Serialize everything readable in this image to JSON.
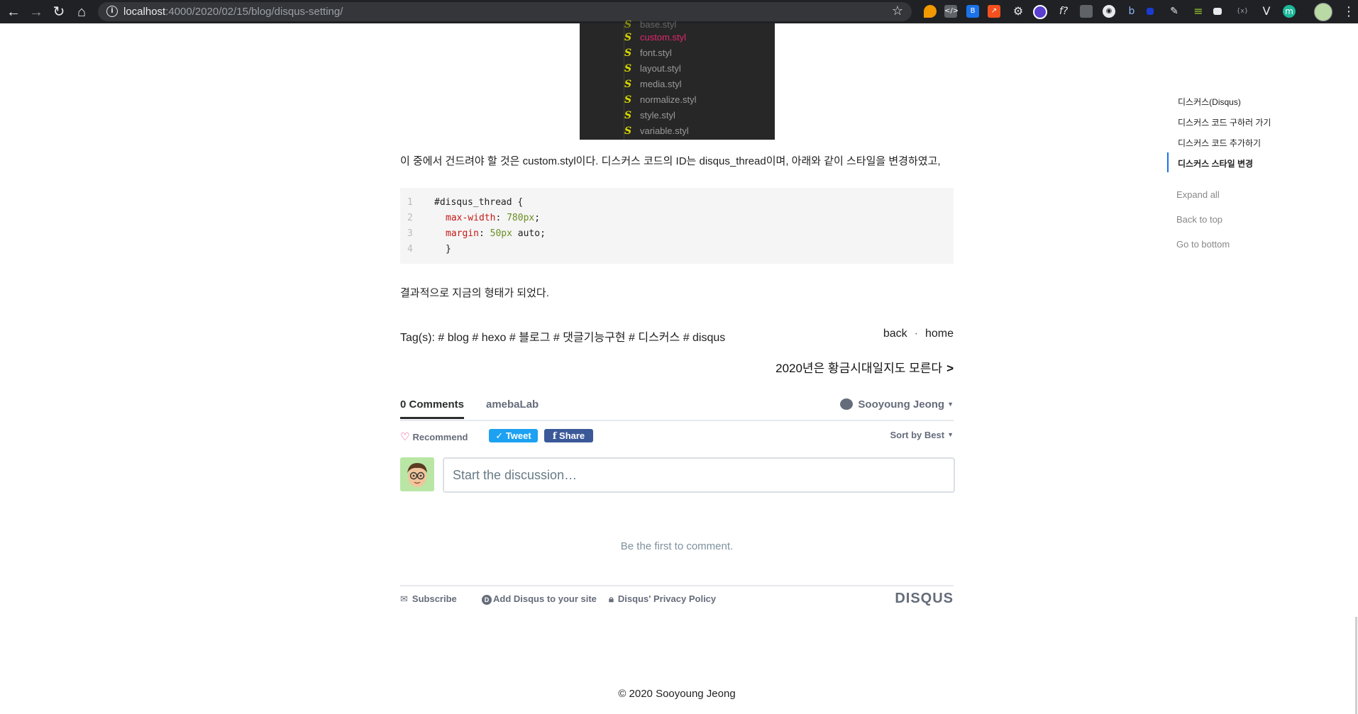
{
  "browser": {
    "url_host": "localhost",
    "url_path": ":4000/2020/02/15/blog/disqus-setting/"
  },
  "filetree": {
    "items": [
      {
        "label": "custom.styl",
        "active": true
      },
      {
        "label": "font.styl",
        "active": false
      },
      {
        "label": "layout.styl",
        "active": false
      },
      {
        "label": "media.styl",
        "active": false
      },
      {
        "label": "normalize.styl",
        "active": false
      },
      {
        "label": "style.styl",
        "active": false
      },
      {
        "label": "variable.styl",
        "active": false
      }
    ]
  },
  "article": {
    "paragraph1": "이 중에서 건드려야 할 것은 custom.styl이다. 디스커스 코드의 ID는 disqus_thread이며, 아래와 같이 스타일을 변경하였고,",
    "code": {
      "line_numbers": [
        "1",
        "2",
        "3",
        "4"
      ],
      "line1": "#disqus_thread {",
      "line2_key": "max-width",
      "line2_val": "780px",
      "line3_key": "margin",
      "line3_val": "50px",
      "line3_rest": " auto;",
      "line4": "}"
    },
    "paragraph2": "결과적으로 지금의 형태가 되었다.",
    "tags_label": "Tag(s):",
    "tags": [
      "# blog",
      "# hexo",
      "# 블로그",
      "# 댓글기능구현",
      "# 디스커스",
      "# disqus"
    ],
    "back": "back",
    "dot": "·",
    "home": "home",
    "next_post": "2020년은 황금시대일지도 모른다",
    "next_arrow": ">"
  },
  "disqus": {
    "comments_tab": "0 Comments",
    "forum_tab": "amebaLab",
    "user": "Sooyoung Jeong",
    "recommend": "Recommend",
    "tweet": "Tweet",
    "share": "Share",
    "sort": "Sort by Best",
    "placeholder": "Start the discussion…",
    "first": "Be the first to comment.",
    "subscribe": "Subscribe",
    "add_disqus": "Add Disqus to your site",
    "privacy": "Disqus' Privacy Policy",
    "logo": "DISQUS"
  },
  "footer": {
    "copyright": "© 2020 Sooyoung Jeong"
  },
  "toc": {
    "items": [
      {
        "label": "디스커스(Disqus)",
        "active": false
      },
      {
        "label": "디스커스 코드 구하러 가기",
        "active": false
      },
      {
        "label": "디스커스 코드 추가하기",
        "active": false
      },
      {
        "label": "디스커스 스타일 변경",
        "active": true
      }
    ],
    "expand_all": "Expand all",
    "back_to_top": "Back to top",
    "go_to_bottom": "Go to bottom"
  },
  "colors": {
    "accent_pink": "#e0266e",
    "twitter": "#1da1f2",
    "facebook": "#3b5998",
    "toc_active_bar": "#1a73e8"
  }
}
